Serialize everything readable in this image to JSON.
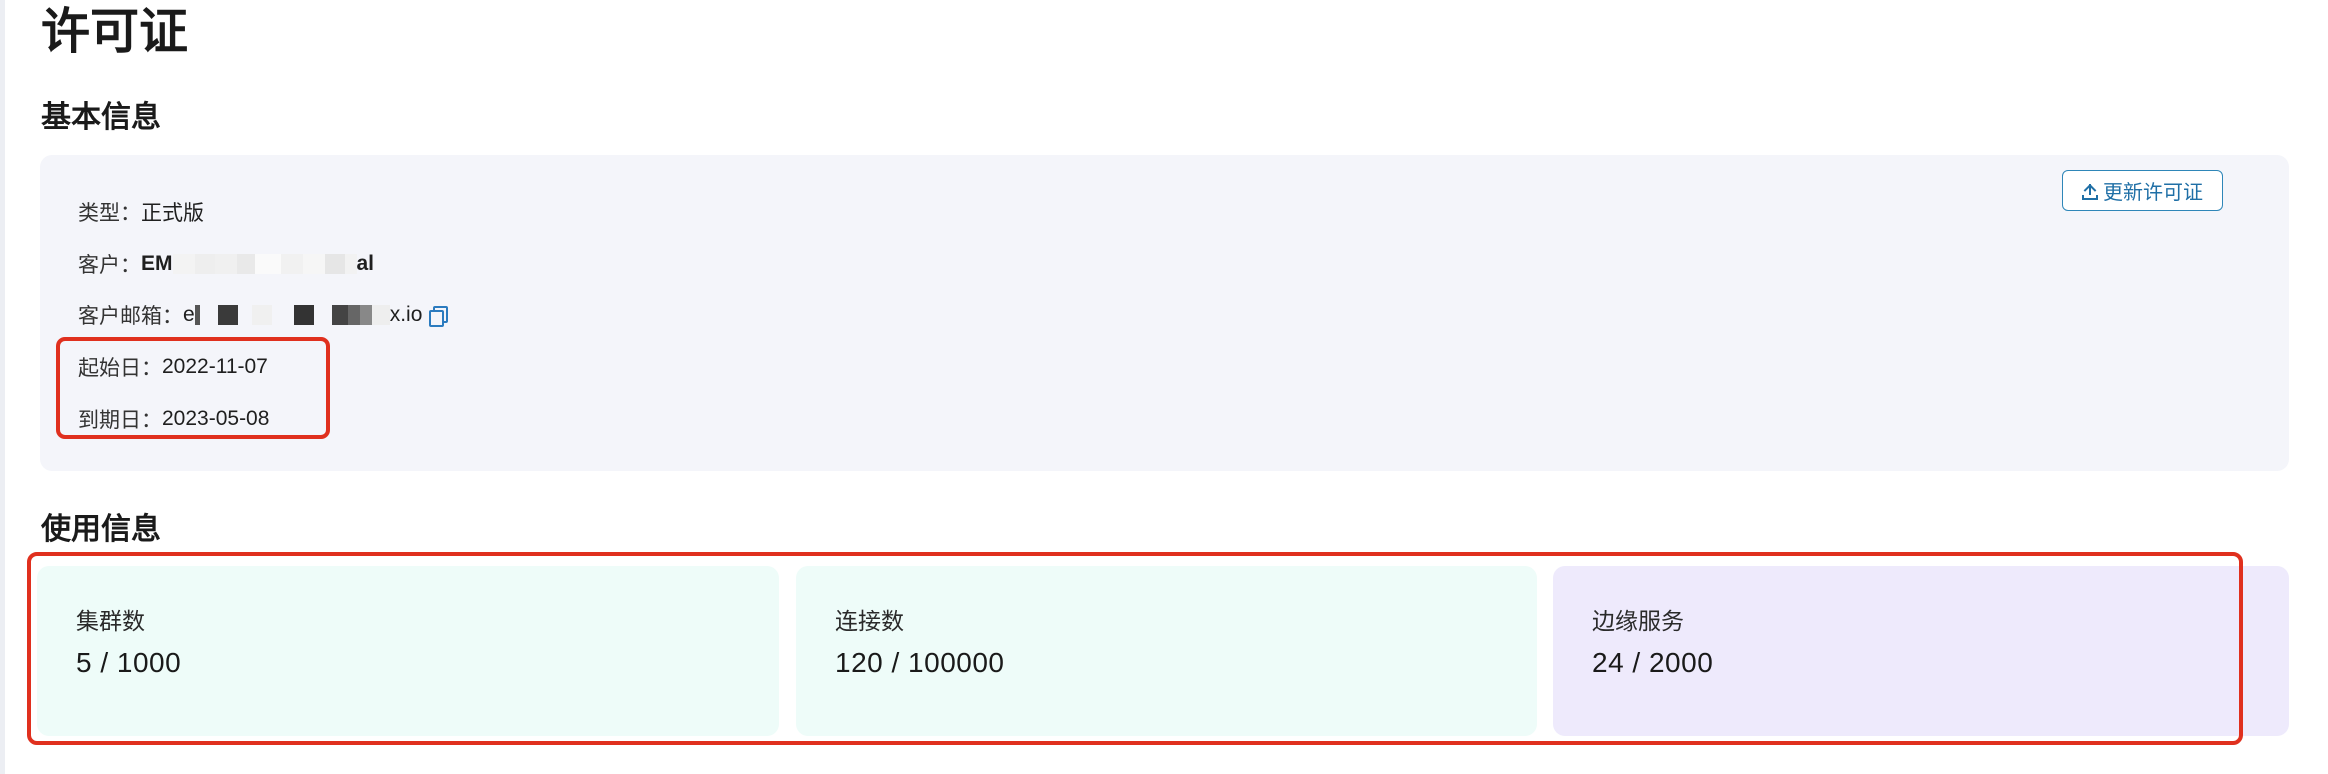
{
  "page": {
    "title": "许可证"
  },
  "basic_info": {
    "section_title": "基本信息",
    "update_button_label": "更新许可证",
    "type_label": "类型：",
    "type_value": "正式版",
    "customer_label": "客户：",
    "customer_value_prefix": "EM",
    "customer_value_suffix": "al",
    "email_label": "客户邮箱：",
    "email_value_prefix": "e",
    "email_value_suffix": "x.io",
    "start_label": "起始日：",
    "start_value": "2022-11-07",
    "end_label": "到期日：",
    "end_value": "2023-05-08"
  },
  "usage_info": {
    "section_title": "使用信息",
    "cards": [
      {
        "label": "集群数",
        "value": "5 / 1000"
      },
      {
        "label": "连接数",
        "value": "120 / 100000"
      },
      {
        "label": "边缘服务",
        "value": "24 / 2000"
      }
    ]
  },
  "icons": {
    "upload": "upload-icon",
    "copy": "copy-icon"
  },
  "colors": {
    "accent": "#2e86b8",
    "highlight": "#e0301e",
    "panel_bg": "#f4f5fa",
    "card_teal": "#eefcf9",
    "card_lavender": "#eeeafc"
  }
}
